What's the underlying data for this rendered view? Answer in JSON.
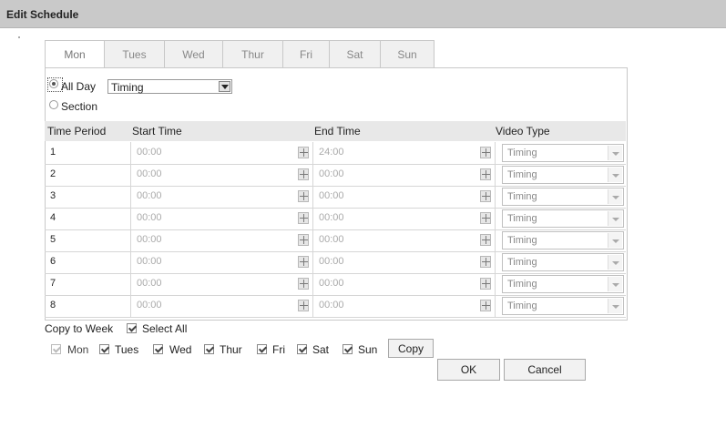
{
  "title": "Edit Schedule",
  "tabs": [
    {
      "label": "Mon",
      "active": true
    },
    {
      "label": "Tues",
      "active": false
    },
    {
      "label": "Wed",
      "active": false
    },
    {
      "label": "Thur",
      "active": false
    },
    {
      "label": "Fri",
      "active": false
    },
    {
      "label": "Sat",
      "active": false
    },
    {
      "label": "Sun",
      "active": false
    }
  ],
  "mode": {
    "all_day_label": "All Day",
    "all_day_selected": true,
    "all_day_type": "Timing",
    "section_label": "Section",
    "section_selected": false
  },
  "table": {
    "headers": [
      "Time Period",
      "Start Time",
      "End Time",
      "Video Type"
    ],
    "rows": [
      {
        "period": "1",
        "start": "00:00",
        "end": "24:00",
        "video_type": "Timing"
      },
      {
        "period": "2",
        "start": "00:00",
        "end": "00:00",
        "video_type": "Timing"
      },
      {
        "period": "3",
        "start": "00:00",
        "end": "00:00",
        "video_type": "Timing"
      },
      {
        "period": "4",
        "start": "00:00",
        "end": "00:00",
        "video_type": "Timing"
      },
      {
        "period": "5",
        "start": "00:00",
        "end": "00:00",
        "video_type": "Timing"
      },
      {
        "period": "6",
        "start": "00:00",
        "end": "00:00",
        "video_type": "Timing"
      },
      {
        "period": "7",
        "start": "00:00",
        "end": "00:00",
        "video_type": "Timing"
      },
      {
        "period": "8",
        "start": "00:00",
        "end": "00:00",
        "video_type": "Timing"
      }
    ],
    "time_picker_icon": "clock-icon"
  },
  "copy": {
    "label": "Copy to Week",
    "select_all_label": "Select All",
    "select_all_checked": true,
    "days": [
      {
        "label": "Mon",
        "checked": true,
        "disabled": true
      },
      {
        "label": "Tues",
        "checked": true,
        "disabled": false
      },
      {
        "label": "Wed",
        "checked": true,
        "disabled": false
      },
      {
        "label": "Thur",
        "checked": true,
        "disabled": false
      },
      {
        "label": "Fri",
        "checked": true,
        "disabled": false
      },
      {
        "label": "Sat",
        "checked": true,
        "disabled": false
      },
      {
        "label": "Sun",
        "checked": true,
        "disabled": false
      }
    ],
    "copy_button": "Copy"
  },
  "actions": {
    "ok": "OK",
    "cancel": "Cancel"
  }
}
